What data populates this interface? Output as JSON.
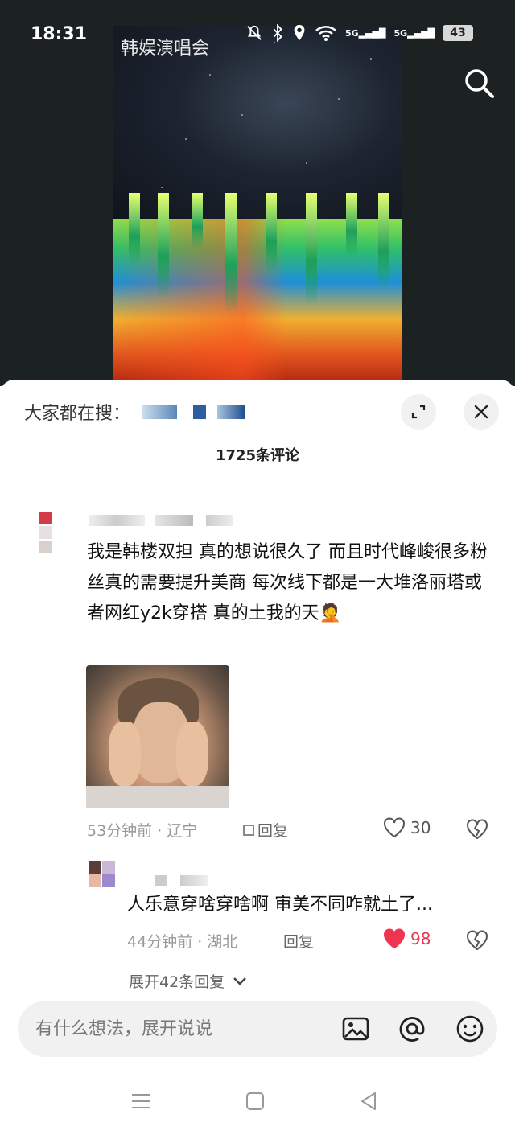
{
  "status_bar": {
    "time": "18:31",
    "battery": "43",
    "signal_labels": [
      "5G",
      "5G"
    ]
  },
  "video": {
    "title": "韩娱演唱会"
  },
  "sheet": {
    "trending_label": "大家都在搜：",
    "comment_count": "1725条评论"
  },
  "comments": [
    {
      "text": "我是韩楼双担 真的想说很久了 而且时代峰峻很多粉丝真的需要提升美商 每次线下都是一大堆洛丽塔或者网红y2k穿搭 真的土我的天🤦",
      "time_location": "53分钟前 · 辽宁",
      "reply_label": "回复",
      "likes": "30",
      "liked": false
    }
  ],
  "replies": [
    {
      "text": "人乐意穿啥穿啥啊 审美不同咋就土了...",
      "time_location": "44分钟前 · 湖北",
      "reply_label": "回复",
      "likes": "98",
      "liked": true
    }
  ],
  "expand_label": "展开42条回复",
  "input": {
    "placeholder": "有什么想法，展开说说"
  },
  "colors": {
    "like_active": "#f0334f",
    "sheet_bg": "#ffffff",
    "video_bg": "#1c2222"
  },
  "icons": [
    "search-icon",
    "expand-icon",
    "close-icon",
    "heart-icon",
    "broken-heart-icon",
    "image-icon",
    "at-icon",
    "emoji-icon",
    "menu-icon",
    "home-icon",
    "back-icon"
  ]
}
